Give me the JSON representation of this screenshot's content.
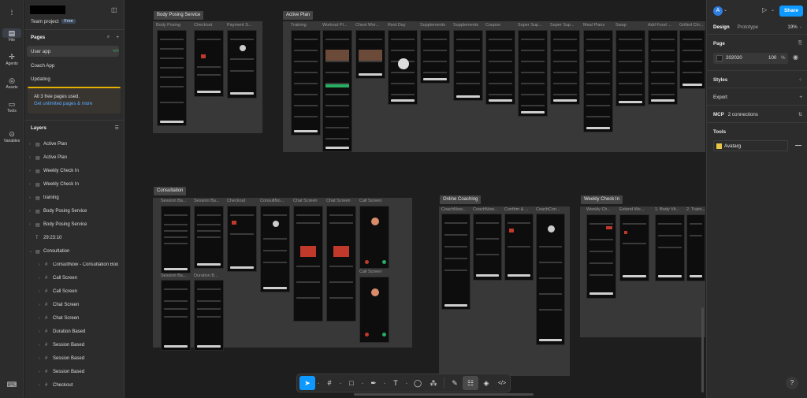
{
  "left_panel": {
    "team_label": "Team project",
    "plan_badge": "Free",
    "pages_header": "Pages",
    "pages": [
      "User app",
      "Coach App",
      "Updating"
    ],
    "notice_title": "All 3 free pages used.",
    "notice_link": "Get unlimited pages & more",
    "layers_header": "Layers",
    "layers": [
      "Active Plan",
      "Active Plan",
      "Weekly Check In",
      "Weekly Check In",
      "training",
      "Body Posing Service",
      "Body Posing Service",
      "29:23:10",
      "Consultation",
      "ConsultNow - Consultation Boo",
      "Call Screen",
      "Call Screen",
      "Chat Screen",
      "Chat Screen",
      "Duration Based",
      "Session Based",
      "Session Based",
      "Session Based",
      "Checkout"
    ]
  },
  "rail": {
    "items": [
      "File",
      "Agents",
      "Assets",
      "Tools",
      "Variables"
    ]
  },
  "canvas": {
    "sections": {
      "body_posing": "Body Posing Service",
      "active_plan": "Active Plan",
      "consultation": "Consultation",
      "online_coaching": "Online Coaching",
      "weekly_check_in": "Weekly Check In"
    },
    "labels": {
      "bp": [
        "Body Posing",
        "Checkout",
        "Payment S..."
      ],
      "ap": [
        "Training",
        "Workout Pl...",
        "Chest Wor...",
        "Rest Day",
        "Supplements",
        "Supplements",
        "Coupon",
        "Super Sup...",
        "Super Sup...",
        "Meal Plans",
        "Swap",
        "Add Food ...",
        "Grilled Chi..."
      ],
      "cons": [
        "Session Ba...",
        "Session Ba...",
        "Checkout",
        "ConsultNo...",
        "Chat Screen",
        "Chat Screen",
        "Call Screen"
      ],
      "cons2": [
        "Session Ba...",
        "Duration B..."
      ],
      "cons_call2": "Call Screen",
      "oc": [
        "CoachNow...",
        "CoachNow...",
        "Confirm & ...",
        "CoachCon..."
      ],
      "wci": [
        "Weekly Ch...",
        "Extend We...",
        "1. Body Vit...",
        "2. Traini..."
      ]
    }
  },
  "toolbar": {
    "tools": [
      "move",
      "frame",
      "shape",
      "pen",
      "text",
      "comment",
      "components",
      "draw",
      "dev",
      "code"
    ]
  },
  "right_panel": {
    "avatar_letter": "A",
    "share_label": "Share",
    "tabs": [
      "Design",
      "Prototype"
    ],
    "zoom": "19%",
    "page_label": "Page",
    "page_color_hex": "202020",
    "page_opacity": "100",
    "percent_sign": "%",
    "styles_label": "Styles",
    "export_label": "Export",
    "mcp_label": "MCP",
    "mcp_connections": "2 connections",
    "tools_label": "Tools",
    "tool_item": "Avatarg",
    "help": "?"
  },
  "colors": {
    "accent": "#0d99ff",
    "canvas": "#1e1e1e",
    "panel": "#2c2c2c",
    "section": "#383838"
  }
}
